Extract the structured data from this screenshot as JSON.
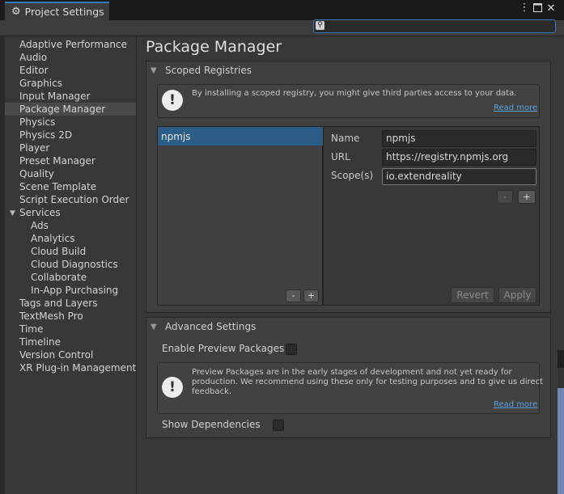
{
  "window": {
    "tab_title": "Project Settings",
    "search": {
      "value": "",
      "placeholder": ""
    }
  },
  "sidebar": {
    "items": [
      {
        "label": "Adaptive Performance",
        "level": 0,
        "selected": false
      },
      {
        "label": "Audio",
        "level": 0,
        "selected": false
      },
      {
        "label": "Editor",
        "level": 0,
        "selected": false
      },
      {
        "label": "Graphics",
        "level": 0,
        "selected": false
      },
      {
        "label": "Input Manager",
        "level": 0,
        "selected": false
      },
      {
        "label": "Package Manager",
        "level": 0,
        "selected": true
      },
      {
        "label": "Physics",
        "level": 0,
        "selected": false
      },
      {
        "label": "Physics 2D",
        "level": 0,
        "selected": false
      },
      {
        "label": "Player",
        "level": 0,
        "selected": false
      },
      {
        "label": "Preset Manager",
        "level": 0,
        "selected": false
      },
      {
        "label": "Quality",
        "level": 0,
        "selected": false
      },
      {
        "label": "Scene Template",
        "level": 0,
        "selected": false
      },
      {
        "label": "Script Execution Order",
        "level": 0,
        "selected": false
      },
      {
        "label": "Services",
        "level": 0,
        "selected": false,
        "expanded": true
      },
      {
        "label": "Ads",
        "level": 1,
        "selected": false
      },
      {
        "label": "Analytics",
        "level": 1,
        "selected": false
      },
      {
        "label": "Cloud Build",
        "level": 1,
        "selected": false
      },
      {
        "label": "Cloud Diagnostics",
        "level": 1,
        "selected": false
      },
      {
        "label": "Collaborate",
        "level": 1,
        "selected": false
      },
      {
        "label": "In-App Purchasing",
        "level": 1,
        "selected": false
      },
      {
        "label": "Tags and Layers",
        "level": 0,
        "selected": false
      },
      {
        "label": "TextMesh Pro",
        "level": 0,
        "selected": false
      },
      {
        "label": "Time",
        "level": 0,
        "selected": false
      },
      {
        "label": "Timeline",
        "level": 0,
        "selected": false
      },
      {
        "label": "Version Control",
        "level": 0,
        "selected": false
      },
      {
        "label": "XR Plug-in Management",
        "level": 0,
        "selected": false
      }
    ]
  },
  "main": {
    "title": "Package Manager",
    "scoped": {
      "header": "Scoped Registries",
      "help_text": "By installing a scoped registry, you might give third parties access to your data.",
      "read_more": "Read more",
      "registries": [
        "npmjs"
      ],
      "name_label": "Name",
      "name_value": "npmjs",
      "url_label": "URL",
      "url_value": "https://registry.npmjs.org",
      "scope_label": "Scope(s)",
      "scope_value": "io.extendreality",
      "scope_minus": "-",
      "scope_plus": "+",
      "list_minus": "-",
      "list_plus": "+",
      "revert": "Revert",
      "apply": "Apply"
    },
    "advanced": {
      "header": "Advanced Settings",
      "enable_preview_label": "Enable Preview Packages",
      "enable_preview_checked": false,
      "help_line1": "Preview Packages are in the early stages of development and not yet ready for",
      "help_line2": "production. We recommend using these only for testing purposes and to give us direct",
      "help_line3": "feedback.",
      "read_more": "Read more",
      "show_deps_label": "Show Dependencies",
      "show_deps_checked": false
    }
  },
  "icons": {
    "settings": "gear-icon",
    "menu": "kebab-icon",
    "maximize": "maximize-icon",
    "close": "close-icon",
    "search": "search-icon",
    "info": "exclamation-icon"
  },
  "colors": {
    "accent": "#3a79bb",
    "selection": "#2c5d87",
    "link": "#5ea0e6"
  }
}
